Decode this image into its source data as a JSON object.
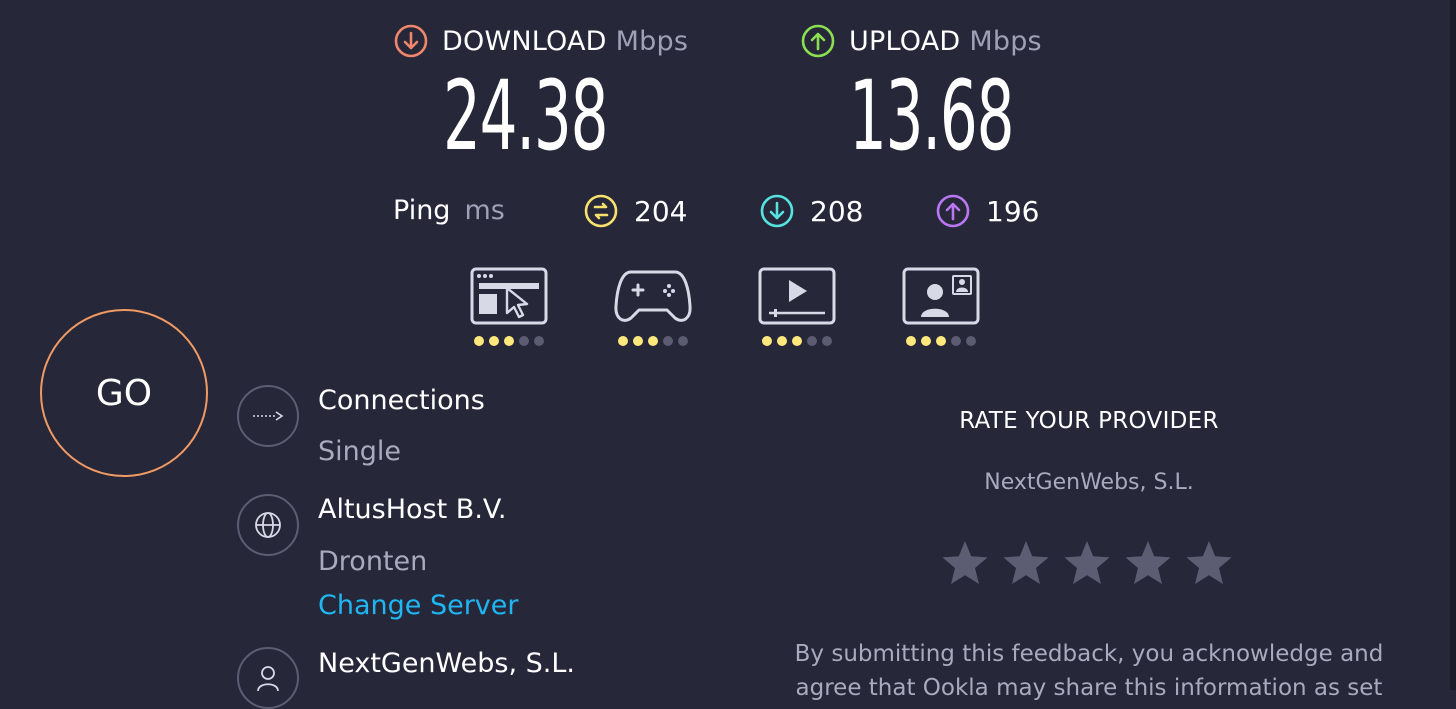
{
  "download": {
    "label": "DOWNLOAD",
    "unit": "Mbps",
    "value": "24.38",
    "color": "#f0866a"
  },
  "upload": {
    "label": "UPLOAD",
    "unit": "Mbps",
    "value": "13.68",
    "color": "#8ae051"
  },
  "ping": {
    "label": "Ping",
    "unit": "ms",
    "idle": {
      "value": "204",
      "icon": "jitter-icon",
      "color": "#f7e06d"
    },
    "download": {
      "value": "208",
      "icon": "arrow-down-icon",
      "color": "#56e3e0"
    },
    "upload": {
      "value": "196",
      "icon": "arrow-up-icon",
      "color": "#b977f2"
    }
  },
  "quality": [
    {
      "name": "web-browsing-icon",
      "rating": 3,
      "max": 5
    },
    {
      "name": "gaming-icon",
      "rating": 3,
      "max": 5
    },
    {
      "name": "streaming-icon",
      "rating": 3,
      "max": 5
    },
    {
      "name": "video-chat-icon",
      "rating": 3,
      "max": 5
    }
  ],
  "go_label": "GO",
  "connections": {
    "title": "Connections",
    "value": "Single"
  },
  "server": {
    "name": "AltusHost B.V.",
    "location": "Dronten",
    "change_label": "Change Server"
  },
  "provider": {
    "name": "NextGenWebs, S.L."
  },
  "rate": {
    "title": "RATE YOUR PROVIDER",
    "provider": "NextGenWebs, S.L.",
    "stars": 5,
    "consent_line1": "By submitting this feedback, you acknowledge and",
    "consent_line2": "agree that Ookla may share this information as set"
  },
  "colors": {
    "background": "#262739",
    "go_ring": "#f09a64",
    "link": "#1fb6f2",
    "star": "#5c5d72"
  }
}
